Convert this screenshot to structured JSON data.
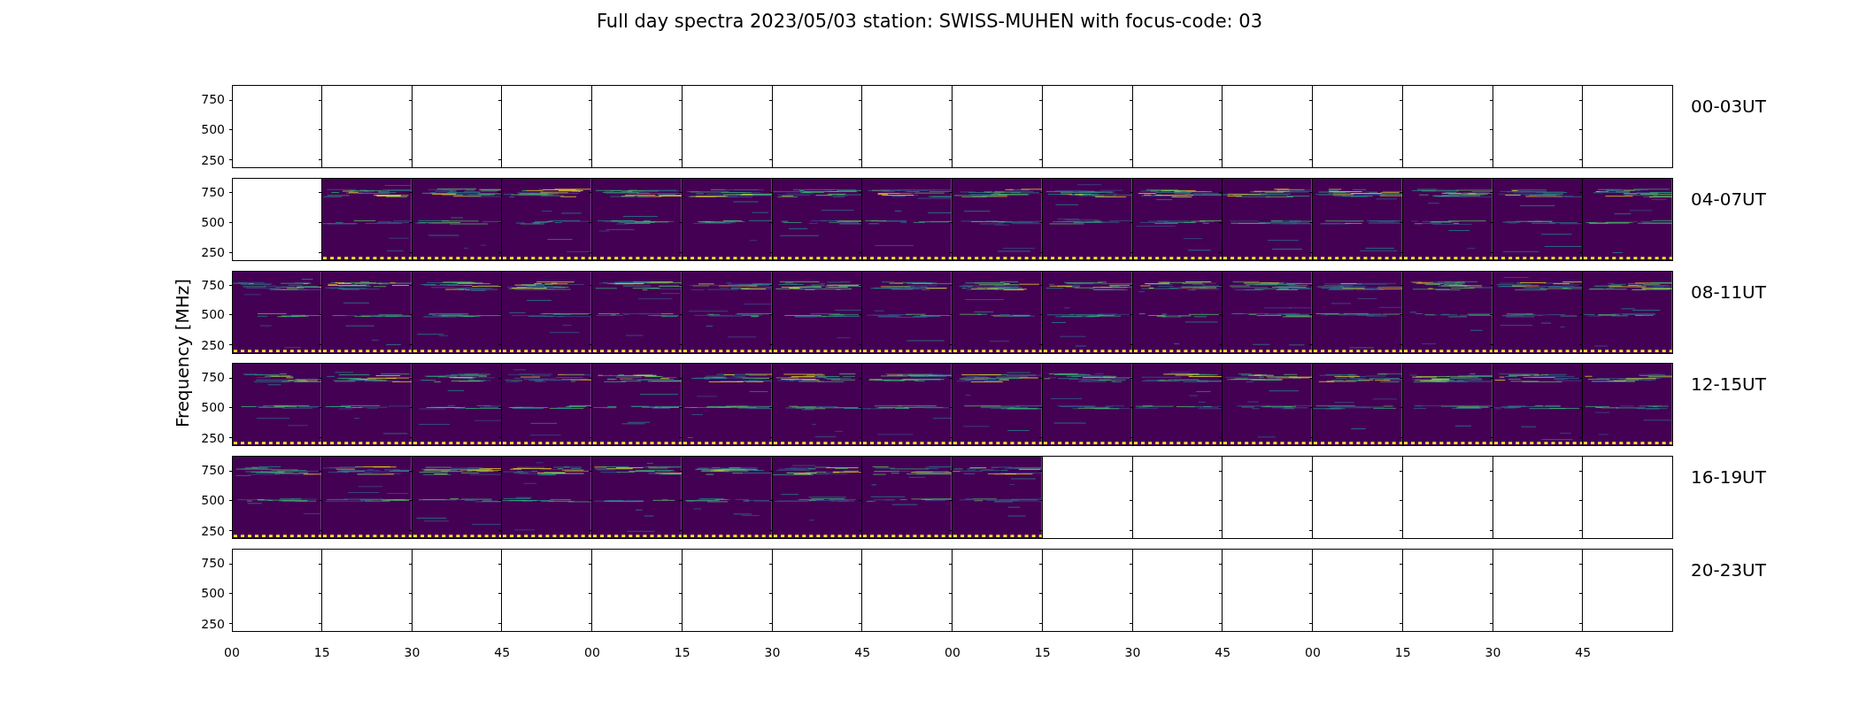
{
  "title": "Full day spectra 2023/05/03 station: SWISS-MUHEN with focus-code: 03",
  "ylabel": "Frequency [MHz]",
  "rows": [
    {
      "label": "00-03UT",
      "yticks": [
        "750",
        "500",
        "250"
      ],
      "panels": [
        {
          "kind": "empty"
        },
        {
          "kind": "empty"
        },
        {
          "kind": "empty"
        },
        {
          "kind": "empty"
        },
        {
          "kind": "empty"
        },
        {
          "kind": "empty"
        },
        {
          "kind": "empty"
        },
        {
          "kind": "empty"
        },
        {
          "kind": "empty"
        },
        {
          "kind": "empty"
        },
        {
          "kind": "empty"
        },
        {
          "kind": "empty"
        },
        {
          "kind": "empty"
        },
        {
          "kind": "empty"
        },
        {
          "kind": "empty"
        },
        {
          "kind": "empty"
        }
      ]
    },
    {
      "label": "04-07UT",
      "yticks": [
        "750",
        "500",
        "250"
      ],
      "panels": [
        {
          "kind": "empty"
        },
        {
          "kind": "spectrum"
        },
        {
          "kind": "spectrum"
        },
        {
          "kind": "spectrum"
        },
        {
          "kind": "spectrum"
        },
        {
          "kind": "spectrum"
        },
        {
          "kind": "spectrum"
        },
        {
          "kind": "spectrum"
        },
        {
          "kind": "spectrum"
        },
        {
          "kind": "spectrum"
        },
        {
          "kind": "spectrum"
        },
        {
          "kind": "spectrum"
        },
        {
          "kind": "spectrum"
        },
        {
          "kind": "spectrum"
        },
        {
          "kind": "spectrum"
        },
        {
          "kind": "spectrum"
        }
      ]
    },
    {
      "label": "08-11UT",
      "yticks": [
        "750",
        "500",
        "250"
      ],
      "panels": [
        {
          "kind": "spectrum"
        },
        {
          "kind": "spectrum"
        },
        {
          "kind": "spectrum"
        },
        {
          "kind": "spectrum"
        },
        {
          "kind": "spectrum"
        },
        {
          "kind": "spectrum"
        },
        {
          "kind": "spectrum"
        },
        {
          "kind": "spectrum"
        },
        {
          "kind": "spectrum"
        },
        {
          "kind": "spectrum"
        },
        {
          "kind": "spectrum"
        },
        {
          "kind": "spectrum"
        },
        {
          "kind": "spectrum"
        },
        {
          "kind": "spectrum"
        },
        {
          "kind": "spectrum"
        },
        {
          "kind": "spectrum"
        }
      ]
    },
    {
      "label": "12-15UT",
      "yticks": [
        "750",
        "500",
        "250"
      ],
      "panels": [
        {
          "kind": "spectrum"
        },
        {
          "kind": "spectrum"
        },
        {
          "kind": "spectrum"
        },
        {
          "kind": "spectrum"
        },
        {
          "kind": "spectrum"
        },
        {
          "kind": "spectrum"
        },
        {
          "kind": "spectrum"
        },
        {
          "kind": "spectrum"
        },
        {
          "kind": "spectrum"
        },
        {
          "kind": "spectrum"
        },
        {
          "kind": "spectrum"
        },
        {
          "kind": "spectrum"
        },
        {
          "kind": "spectrum"
        },
        {
          "kind": "spectrum"
        },
        {
          "kind": "spectrum"
        },
        {
          "kind": "spectrum"
        }
      ]
    },
    {
      "label": "16-19UT",
      "yticks": [
        "750",
        "500",
        "250"
      ],
      "panels": [
        {
          "kind": "spectrum"
        },
        {
          "kind": "spectrum"
        },
        {
          "kind": "spectrum"
        },
        {
          "kind": "spectrum"
        },
        {
          "kind": "spectrum"
        },
        {
          "kind": "spectrum"
        },
        {
          "kind": "spectrum"
        },
        {
          "kind": "spectrum"
        },
        {
          "kind": "spectrum"
        },
        {
          "kind": "empty"
        },
        {
          "kind": "empty"
        },
        {
          "kind": "empty"
        },
        {
          "kind": "empty"
        },
        {
          "kind": "empty"
        },
        {
          "kind": "empty"
        },
        {
          "kind": "empty"
        }
      ]
    },
    {
      "label": "20-23UT",
      "yticks": [
        "750",
        "500",
        "250"
      ],
      "panels": [
        {
          "kind": "empty"
        },
        {
          "kind": "empty"
        },
        {
          "kind": "empty"
        },
        {
          "kind": "empty"
        },
        {
          "kind": "empty"
        },
        {
          "kind": "empty"
        },
        {
          "kind": "empty"
        },
        {
          "kind": "empty"
        },
        {
          "kind": "empty"
        },
        {
          "kind": "empty"
        },
        {
          "kind": "empty"
        },
        {
          "kind": "empty"
        },
        {
          "kind": "empty"
        },
        {
          "kind": "empty"
        },
        {
          "kind": "empty"
        },
        {
          "kind": "empty"
        }
      ]
    }
  ],
  "xticks": [
    "00",
    "15",
    "30",
    "45",
    "00",
    "15",
    "30",
    "45",
    "00",
    "15",
    "30",
    "45",
    "00",
    "15",
    "30",
    "45"
  ]
}
